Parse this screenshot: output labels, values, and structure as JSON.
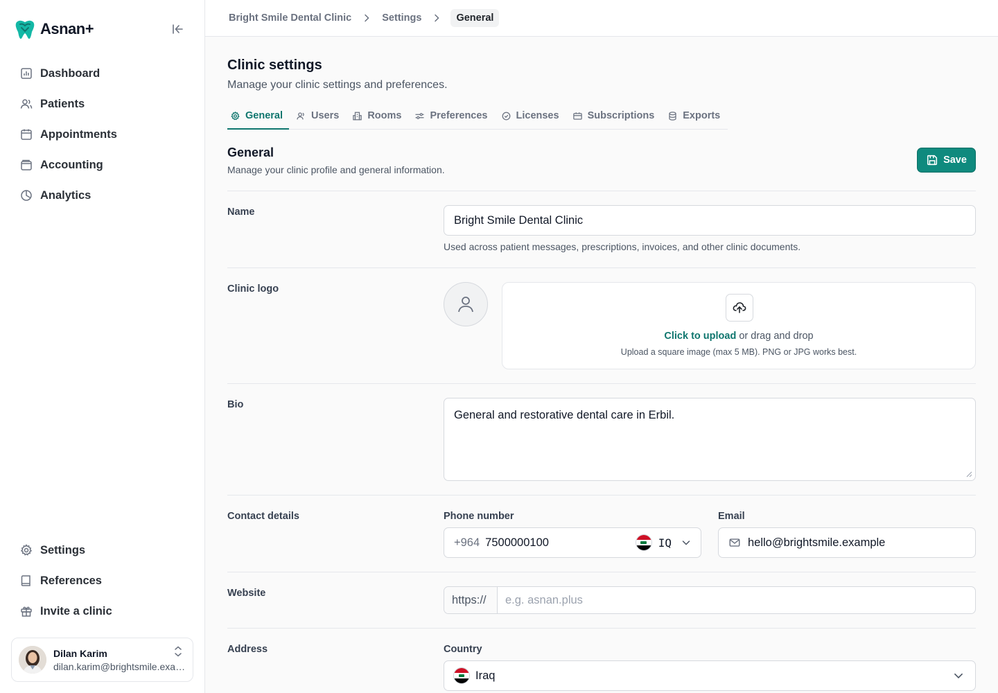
{
  "app": {
    "name": "Asnan+",
    "brand_color": "#0f766e",
    "accent_color": "#0f8a7e"
  },
  "sidebar": {
    "items": [
      {
        "label": "Dashboard",
        "icon": "chart-icon"
      },
      {
        "label": "Patients",
        "icon": "users-icon"
      },
      {
        "label": "Appointments",
        "icon": "calendar-icon"
      },
      {
        "label": "Accounting",
        "icon": "wallet-icon"
      },
      {
        "label": "Analytics",
        "icon": "pie-chart-icon"
      }
    ],
    "bottom_items": [
      {
        "label": "Settings",
        "icon": "gear-icon"
      },
      {
        "label": "References",
        "icon": "book-icon"
      },
      {
        "label": "Invite a clinic",
        "icon": "gift-icon"
      }
    ],
    "user": {
      "name": "Dilan Karim",
      "email": "dilan.karim@brightsmile.example"
    }
  },
  "breadcrumb": [
    "Bright Smile Dental Clinic",
    "Settings",
    "General"
  ],
  "page": {
    "title": "Clinic settings",
    "subtitle": "Manage your clinic settings and preferences."
  },
  "tabs": [
    {
      "label": "General",
      "icon": "gear-icon",
      "active": true
    },
    {
      "label": "Users",
      "icon": "users-icon"
    },
    {
      "label": "Rooms",
      "icon": "building-icon"
    },
    {
      "label": "Preferences",
      "icon": "sliders-icon"
    },
    {
      "label": "Licenses",
      "icon": "badge-check-icon"
    },
    {
      "label": "Subscriptions",
      "icon": "ticket-icon"
    },
    {
      "label": "Exports",
      "icon": "database-icon"
    }
  ],
  "section": {
    "title": "General",
    "subtitle": "Manage your clinic profile and general information.",
    "save_label": "Save"
  },
  "form": {
    "name": {
      "label": "Name",
      "value": "Bright Smile Dental Clinic",
      "hint": "Used across patient messages, prescriptions, invoices, and other clinic documents."
    },
    "logo": {
      "label": "Clinic logo",
      "upload_link": "Click to upload",
      "upload_rest": " or drag and drop",
      "upload_note": "Upload a square image (max 5 MB). PNG or JPG works best."
    },
    "bio": {
      "label": "Bio",
      "value": "General and restorative dental care in Erbil."
    },
    "contact": {
      "label": "Contact details",
      "phone_label": "Phone number",
      "phone_prefix": "+964",
      "phone_value": "7500000100",
      "phone_country": "IQ",
      "email_label": "Email",
      "email_value": "hello@brightsmile.example"
    },
    "website": {
      "label": "Website",
      "scheme": "https://",
      "placeholder": "e.g. asnan.plus"
    },
    "address": {
      "label": "Address",
      "country_label": "Country",
      "country_value": "Iraq"
    }
  }
}
